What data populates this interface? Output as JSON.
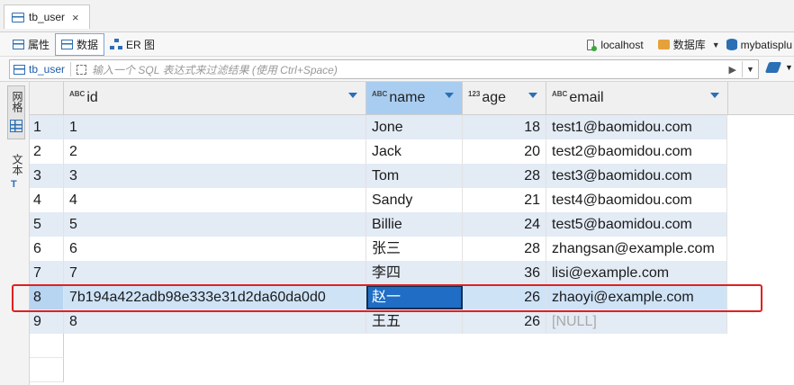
{
  "tab": {
    "title": "tb_user",
    "close": "×"
  },
  "subtabs": [
    {
      "label": "属性"
    },
    {
      "label": "数据"
    },
    {
      "label": "ER 图"
    }
  ],
  "connection": {
    "host": "localhost",
    "database": "数据库",
    "schema": "mybatisplu"
  },
  "filter": {
    "table": "tb_user",
    "placeholder": "输入一个 SQL 表达式来过滤结果 (使用 Ctrl+Space)"
  },
  "side_panel": {
    "grid_label": "网格",
    "text_label": "文本"
  },
  "columns": [
    {
      "name": "id",
      "type_badge": "ABC"
    },
    {
      "name": "name",
      "type_badge": "ABC"
    },
    {
      "name": "age",
      "type_badge": "123"
    },
    {
      "name": "email",
      "type_badge": "ABC"
    }
  ],
  "rows": [
    {
      "n": "1",
      "id": "1",
      "name": "Jone",
      "age": "18",
      "email": "test1@baomidou.com"
    },
    {
      "n": "2",
      "id": "2",
      "name": "Jack",
      "age": "20",
      "email": "test2@baomidou.com"
    },
    {
      "n": "3",
      "id": "3",
      "name": "Tom",
      "age": "28",
      "email": "test3@baomidou.com"
    },
    {
      "n": "4",
      "id": "4",
      "name": "Sandy",
      "age": "21",
      "email": "test4@baomidou.com"
    },
    {
      "n": "5",
      "id": "5",
      "name": "Billie",
      "age": "24",
      "email": "test5@baomidou.com"
    },
    {
      "n": "6",
      "id": "6",
      "name": "张三",
      "age": "28",
      "email": "zhangsan@example.com"
    },
    {
      "n": "7",
      "id": "7",
      "name": "李四",
      "age": "36",
      "email": "lisi@example.com"
    },
    {
      "n": "8",
      "id": "7b194a422adb98e333e31d2da60da0d0",
      "name": "赵一",
      "age": "26",
      "email": "zhaoyi@example.com"
    },
    {
      "n": "9",
      "id": "8",
      "name": "王五",
      "age": "26",
      "email": "[NULL]"
    }
  ],
  "colors": {
    "accent": "#2b6fb5",
    "highlight": "#e02020",
    "selected_cell": "#1f6dc4"
  }
}
